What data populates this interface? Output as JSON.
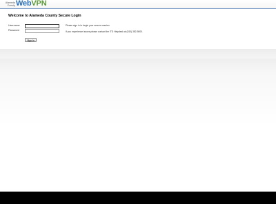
{
  "header": {
    "logo_line1": "Alameda",
    "logo_line2": "County",
    "logo_web": "Web",
    "logo_vpn": "VPN"
  },
  "login": {
    "title": "Welcome to Alameda County Secure Login",
    "username_label": "Username",
    "password_label": "Password",
    "username_value": "",
    "password_value": "",
    "signin_label": "Sign In"
  },
  "messages": {
    "line1": "Please sign in to begin your secure session.",
    "line2": "If you experience issues please contact the ITD Helpdesk at (510) 382-5000."
  },
  "colors": {
    "logo_web": "#2a6db5",
    "logo_vpn": "#5a9a36",
    "header_rule": "#7a9cc6",
    "footer": "#000000"
  }
}
